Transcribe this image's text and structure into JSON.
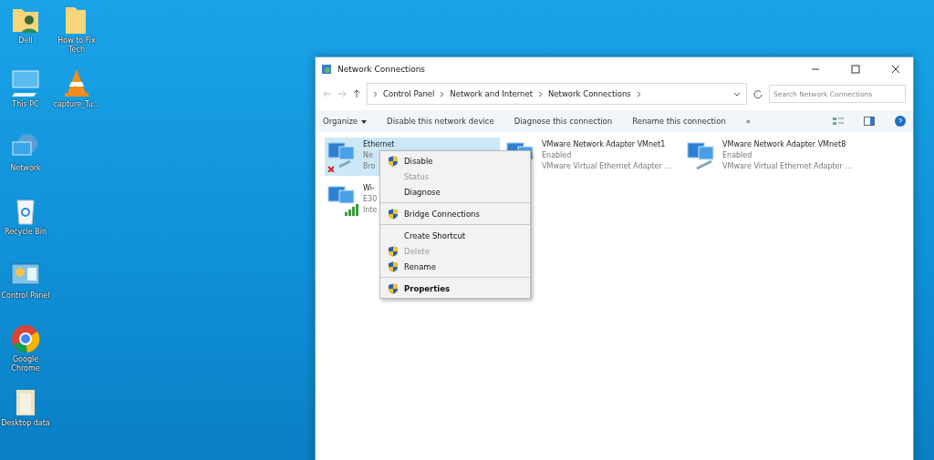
{
  "desktop_icons": [
    {
      "label": "Dell",
      "kind": "user-folder"
    },
    {
      "label": "How to Fix Tech",
      "kind": "folder"
    },
    {
      "label": "This PC",
      "kind": "pc"
    },
    {
      "label": "capture_Tu...",
      "kind": "cone"
    },
    {
      "label": "Network",
      "kind": "network"
    },
    {
      "label": "Recycle Bin",
      "kind": "bin"
    },
    {
      "label": "Control Panel",
      "kind": "panel"
    },
    {
      "label": "Google Chrome",
      "kind": "chrome"
    },
    {
      "label": "Desktop data",
      "kind": "file"
    }
  ],
  "window": {
    "title": "Network Connections",
    "address": {
      "crumbs": [
        "Control Panel",
        "Network and Internet",
        "Network Connections"
      ]
    },
    "search": {
      "placeholder": "Search Network Connections"
    },
    "commands": [
      "Organize",
      "Disable this network device",
      "Diagnose this connection",
      "Rename this connection",
      "»"
    ],
    "connections": [
      {
        "name": "Ethernet",
        "status": "Ne",
        "device": "Bro",
        "selected": true,
        "kind": "wired-disabled"
      },
      {
        "name": "VMware Network Adapter VMnet1",
        "status": "Enabled",
        "device": "VMware Virtual Ethernet Adapter ...",
        "selected": false,
        "kind": "virtual"
      },
      {
        "name": "VMware Network Adapter VMnet8",
        "status": "Enabled",
        "device": "VMware Virtual Ethernet Adapter ...",
        "selected": false,
        "kind": "virtual"
      },
      {
        "name": "Wi-",
        "status": "E30",
        "device": "Inte",
        "selected": false,
        "kind": "wifi"
      }
    ]
  },
  "context_menu": [
    {
      "label": "Disable",
      "shield": true,
      "disabled": false,
      "bold": false
    },
    {
      "label": "Status",
      "shield": false,
      "disabled": true,
      "bold": false
    },
    {
      "label": "Diagnose",
      "shield": false,
      "disabled": false,
      "bold": false,
      "separator_after": true
    },
    {
      "label": "Bridge Connections",
      "shield": true,
      "disabled": false,
      "bold": false,
      "separator_after": true
    },
    {
      "label": "Create Shortcut",
      "shield": false,
      "disabled": false,
      "bold": false
    },
    {
      "label": "Delete",
      "shield": true,
      "disabled": true,
      "bold": false
    },
    {
      "label": "Rename",
      "shield": true,
      "disabled": false,
      "bold": false,
      "separator_after": true
    },
    {
      "label": "Properties",
      "shield": true,
      "disabled": false,
      "bold": true
    }
  ]
}
